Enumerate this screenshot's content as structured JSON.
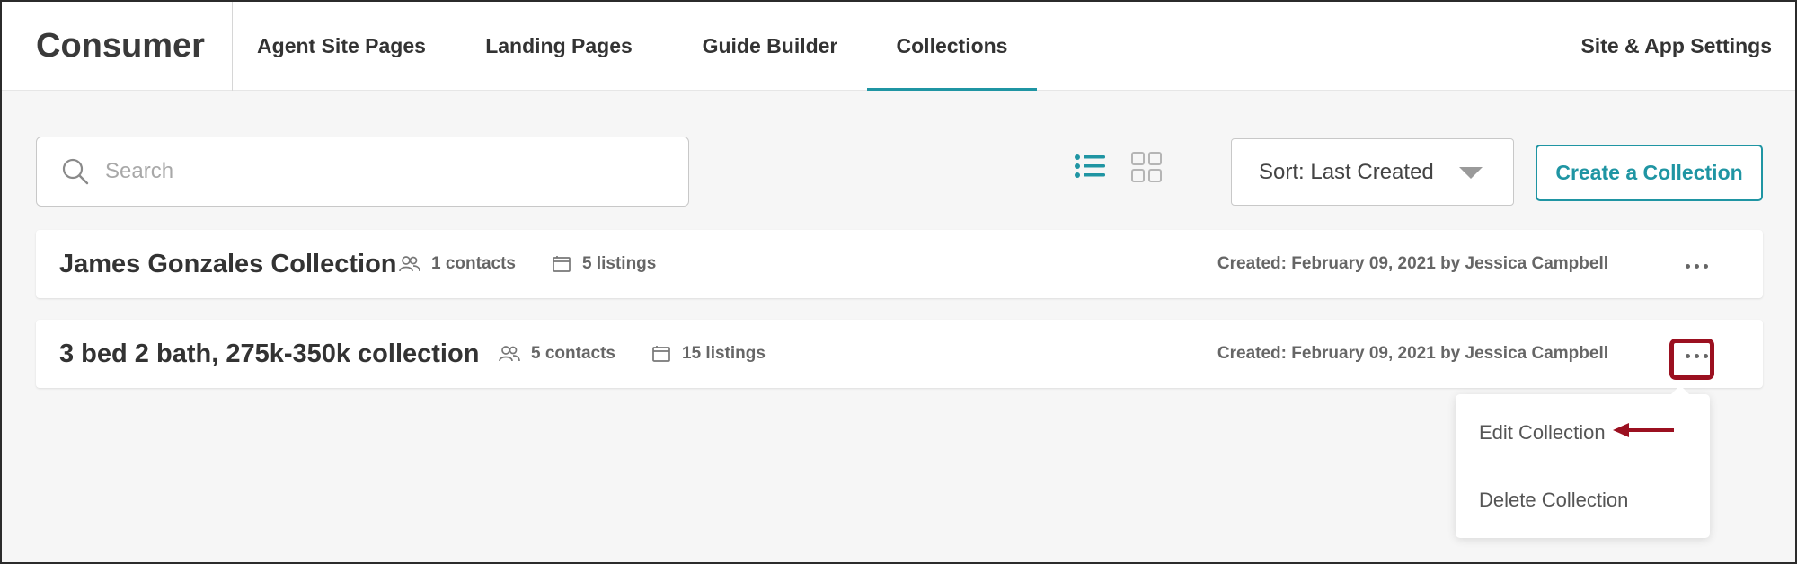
{
  "header": {
    "brand": "Consumer",
    "tabs": [
      {
        "label": "Agent Site Pages"
      },
      {
        "label": "Landing Pages"
      },
      {
        "label": "Guide Builder"
      },
      {
        "label": "Collections",
        "active": true
      }
    ],
    "settings_label": "Site & App Settings"
  },
  "toolbar": {
    "search_placeholder": "Search",
    "sort_label": "Sort: Last Created",
    "create_label": "Create a Collection"
  },
  "collections": [
    {
      "title": "James Gonzales Collection",
      "contacts": "1 contacts",
      "listings": "5 listings",
      "created": "Created: February 09, 2021 by Jessica Campbell"
    },
    {
      "title": "3 bed 2 bath, 275k-350k collection",
      "contacts": "5 contacts",
      "listings": "15 listings",
      "created": "Created: February 09, 2021 by Jessica Campbell"
    }
  ],
  "menu": {
    "items": [
      {
        "label": "Edit Collection"
      },
      {
        "label": "Delete Collection"
      }
    ]
  },
  "colors": {
    "accent": "#1f95a3",
    "highlight": "#9b1020",
    "background": "#f6f6f6"
  }
}
